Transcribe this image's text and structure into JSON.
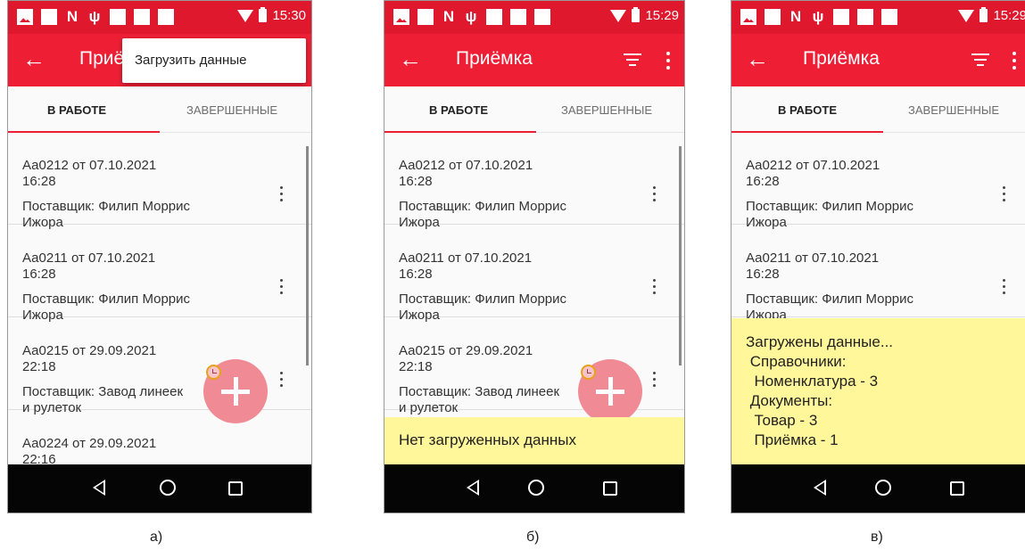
{
  "status": {
    "time_a": "15:30",
    "time_b": "15:29",
    "time_c": "15:29"
  },
  "appbar": {
    "title": "Приёмка",
    "title_truncated": "Приё"
  },
  "menu": {
    "load_data": "Загрузить данные"
  },
  "tabs": {
    "in_progress": "В РАБОТЕ",
    "completed": "ЗАВЕРШЕННЫЕ"
  },
  "items": [
    {
      "title": "Аа0212 от 07.10.2021 16:28",
      "supplier": "Поставщик: Филип Моррис Ижора"
    },
    {
      "title": "Аа0211 от 07.10.2021 16:28",
      "supplier": "Поставщик: Филип Моррис Ижора"
    },
    {
      "title": "Аа0215 от 29.09.2021 22:18",
      "supplier": "Поставщик: Завод линеек и рулеток"
    },
    {
      "title": "Аа0224 от 29.09.2021 22:16",
      "supplier": ""
    }
  ],
  "toast_b": "Нет загруженных данных",
  "toast_c": {
    "line1": "Загружены данные...",
    "line2": " Справочники:",
    "line3": "  Номенклатура - 3",
    "line4": " Документы:",
    "line5": "  Товар - 3",
    "line6": "  Приёмка - 1"
  },
  "captions": {
    "a": "а)",
    "b": "б)",
    "c": "в)"
  },
  "icons": {
    "back": "arrow-left-icon",
    "filter": "filter-icon",
    "more": "kebab-icon",
    "add": "plus-icon",
    "clock": "clock-icon"
  },
  "colors": {
    "primary": "#ee1f35",
    "status": "#e0182e",
    "fab": "#f08a94",
    "toast": "#fff799"
  }
}
